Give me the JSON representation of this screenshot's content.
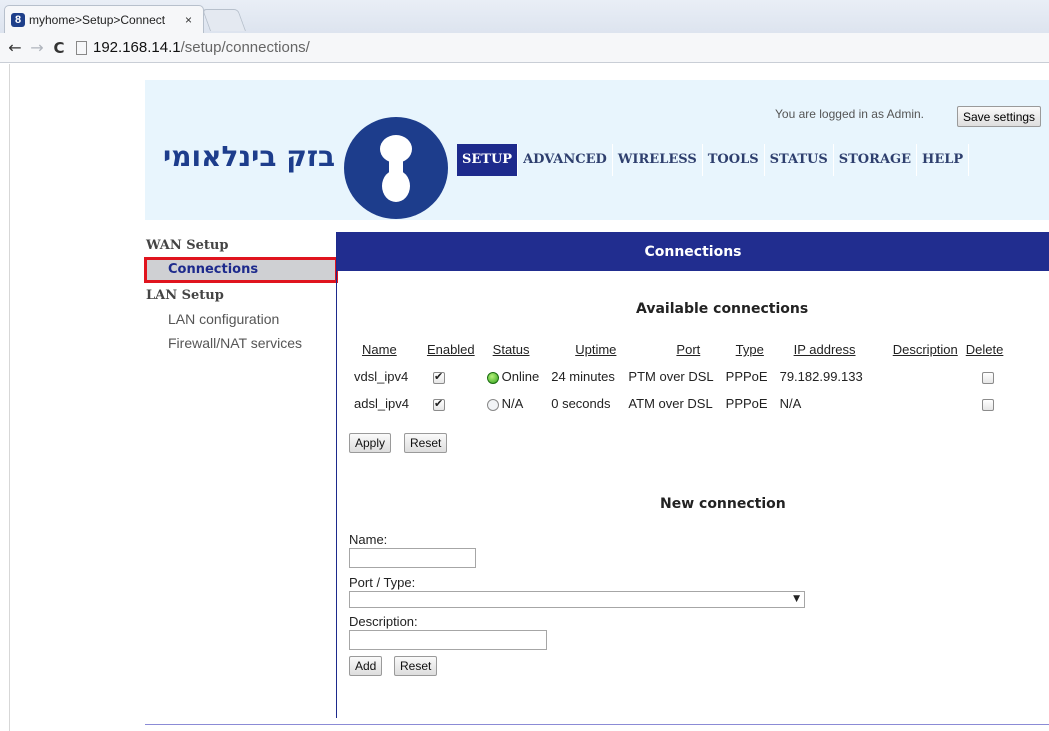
{
  "browser": {
    "tab_title": "myhome>Setup>Connect",
    "tab_favicon": "8",
    "tab_close": "×",
    "url_host": "192.168.14.1",
    "url_path": "/setup/connections/",
    "icons": {
      "back": "←",
      "forward": "→",
      "reload": "C"
    }
  },
  "header": {
    "logo_text": "בזק בינלאומי",
    "login_text": "You are logged in as Admin.",
    "save_label": "Save settings",
    "nav": [
      "SETUP",
      "ADVANCED",
      "WIRELESS",
      "TOOLS",
      "STATUS",
      "STORAGE",
      "HELP"
    ],
    "colors": {
      "brand": "#1d3d8c",
      "nav_active": "#1d2a8c"
    }
  },
  "sidebar": {
    "sections": [
      {
        "title": "WAN Setup",
        "items": [
          "Connections"
        ]
      },
      {
        "title": "LAN Setup",
        "items": [
          "LAN configuration",
          "Firewall/NAT services"
        ]
      }
    ]
  },
  "main": {
    "title": "Connections",
    "available_title": "Available connections",
    "columns": [
      "Name",
      "Enabled",
      "Status",
      "Uptime",
      "Port",
      "Type",
      "IP address",
      "Description",
      "Delete"
    ],
    "rows": [
      {
        "name": "vdsl_ipv4",
        "enabled": true,
        "status": "Online",
        "uptime": "24 minutes",
        "port": "PTM over DSL",
        "type": "PPPoE",
        "ip": "79.182.99.133",
        "description": "",
        "delete": false
      },
      {
        "name": "adsl_ipv4",
        "enabled": true,
        "status": "N/A",
        "uptime": "0 seconds",
        "port": "ATM over DSL",
        "type": "PPPoE",
        "ip": "N/A",
        "description": "",
        "delete": false
      }
    ],
    "apply_label": "Apply",
    "reset_label": "Reset",
    "new_title": "New connection",
    "form": {
      "name_label": "Name:",
      "port_type_label": "Port / Type:",
      "description_label": "Description:",
      "add_label": "Add",
      "reset_label": "Reset",
      "select_arrow": "▼"
    }
  }
}
